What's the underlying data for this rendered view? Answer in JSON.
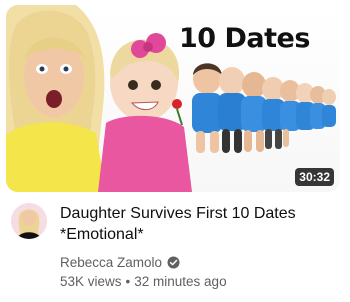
{
  "video": {
    "thumbnail_text": "10 Dates",
    "duration": "30:32",
    "title_line1": "Daughter Survives First 10 Dates",
    "title_line2": "*Emotional*",
    "channel_name": "Rebecca Zamolo",
    "views": "53K views",
    "separator": "•",
    "age": "32 minutes ago"
  },
  "icons": {
    "verified": "verified-check-icon"
  },
  "colors": {
    "text_primary": "#0f0f0f",
    "text_secondary": "#606060",
    "duration_bg": "#141414",
    "thumb_shirt_yellow": "#f4e64a",
    "thumb_dress_pink": "#e8579f",
    "thumb_babies_blue": "#2f86d8"
  }
}
